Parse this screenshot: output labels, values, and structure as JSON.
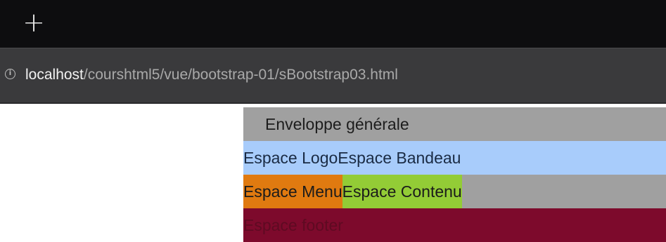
{
  "browser": {
    "new_tab_symbol": "+",
    "address": {
      "host": "localhost",
      "path": "/courshtml5/vue/bootstrap-01/sBootstrap03.html"
    }
  },
  "page": {
    "wrapper_label": "Enveloppe générale",
    "header": {
      "logo": "Espace Logo",
      "bandeau": "Espace Bandeau"
    },
    "main": {
      "menu": "Espace Menu",
      "contenu": "Espace Contenu"
    },
    "footer": "Espace footer"
  },
  "colors": {
    "wrapper": "#a0a0a0",
    "header": "#a8ccfb",
    "menu": "#e07a10",
    "contenu": "#93cc36",
    "footer": "#7d0a2c"
  }
}
